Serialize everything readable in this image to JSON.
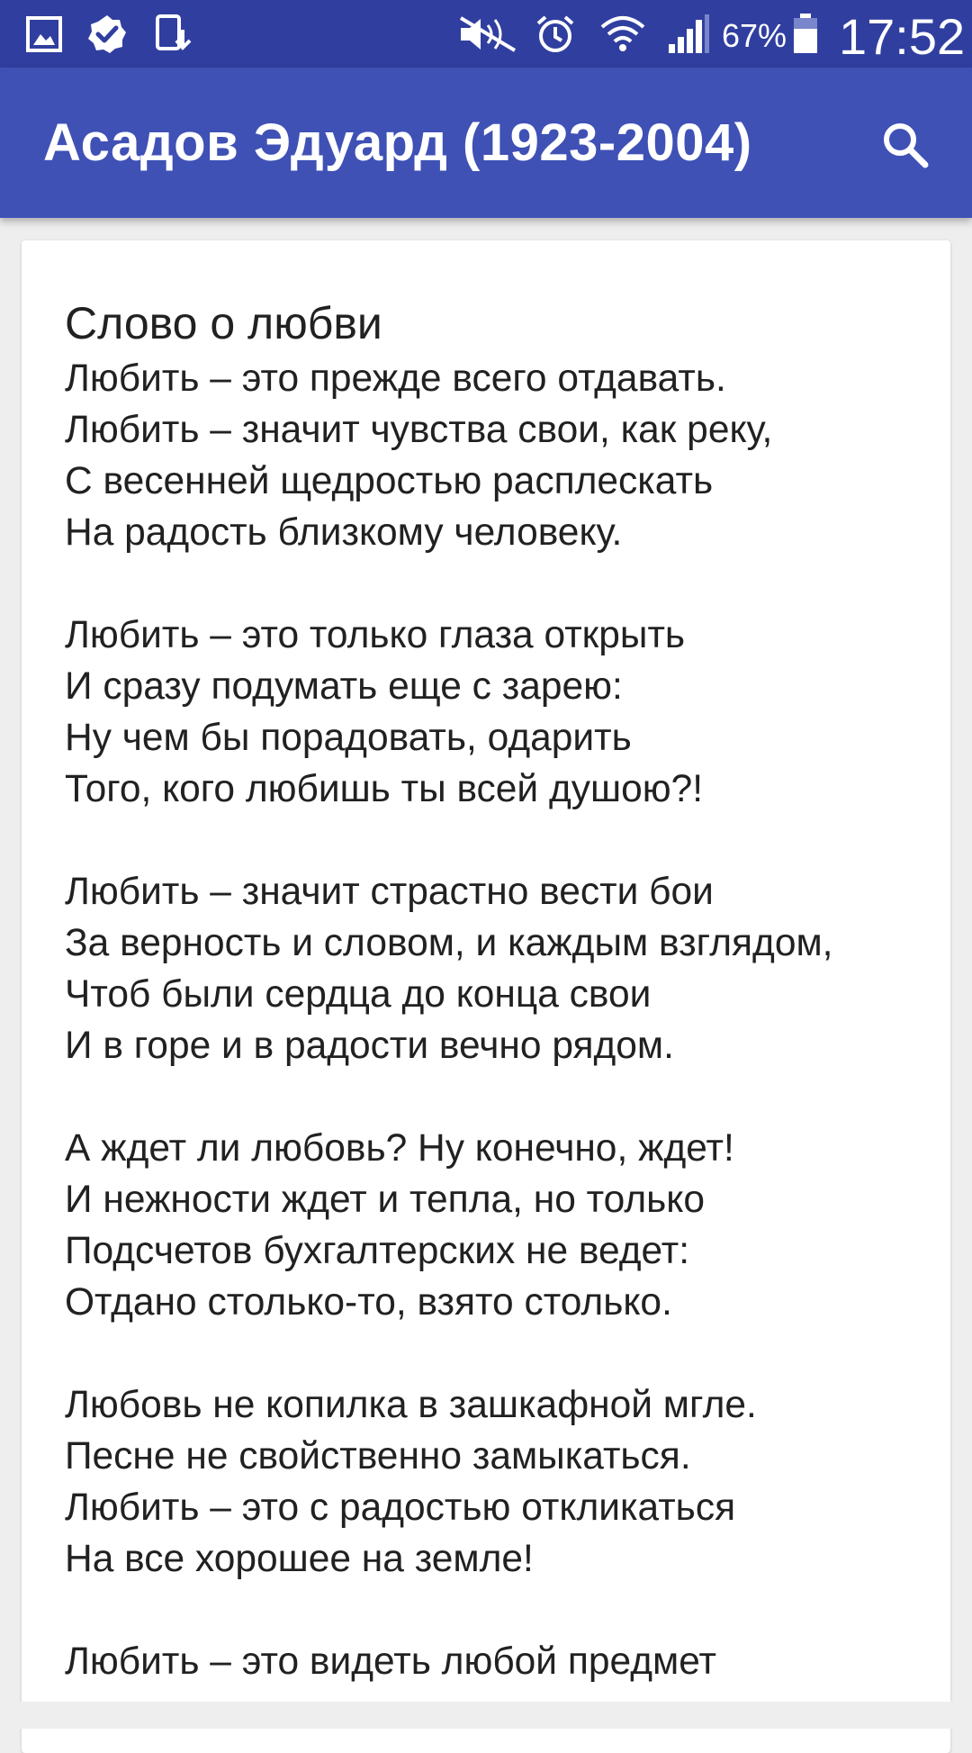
{
  "status_bar": {
    "icons": [
      "gallery-icon",
      "check-badge-icon",
      "download-icon",
      "mute-icon",
      "alarm-icon",
      "wifi-icon",
      "signal-icon",
      "battery-icon"
    ],
    "battery_percent": "67%",
    "time": "17:52"
  },
  "app_bar": {
    "title": "Асадов Эдуард (1923-2004)",
    "search_icon": "search-icon"
  },
  "poem": {
    "title": "Слово о любви",
    "text": "Любить – это прежде всего отдавать.\nЛюбить – значит чувства свои, как реку,\nС весенней щедростью расплескать\nНа радость близкому человеку.\n\nЛюбить – это только глаза открыть\nИ сразу подумать еще с зарею:\nНу чем бы порадовать, одарить\nТого, кого любишь ты всей душою?!\n\nЛюбить – значит страстно вести бои\nЗа верность и словом, и каждым взглядом,\nЧтоб были сердца до конца свои\nИ в горе и в радости вечно рядом.\n\nА ждет ли любовь? Ну конечно, ждет!\nИ нежности ждет и тепла, но только\nПодсчетов бухгалтерских не ведет:\nОтдано столько-то, взято столько.\n\nЛюбовь не копилка в зашкафной мгле.\nПесне не свойственно замыкаться.\nЛюбить – это с радостью откликаться\nНа все хорошее на земле!\n\nЛюбить – это видеть любой предмет"
  },
  "colors": {
    "status_bar": "#303f9f",
    "app_bar": "#3f51b5",
    "background": "#eeeeee",
    "card": "#ffffff",
    "text": "#212121"
  }
}
